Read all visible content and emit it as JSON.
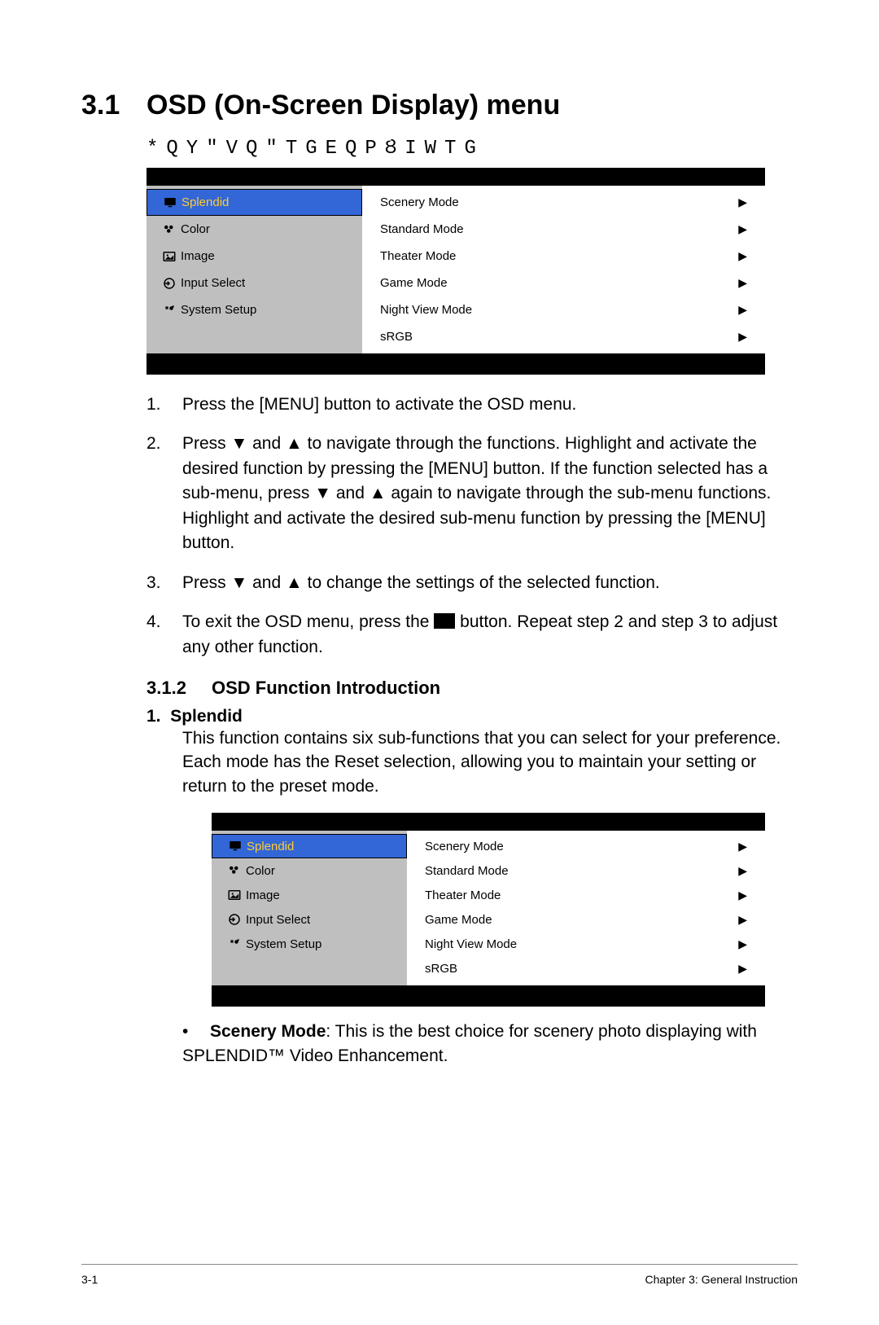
{
  "section": {
    "number": "3.1",
    "title": "OSD (On-Screen Display) menu"
  },
  "config_line": "*QY\"VQ\"TGEQPȢIWTG",
  "osd": {
    "left_items": [
      {
        "label": "Splendid",
        "icon": "monitor",
        "selected": true
      },
      {
        "label": "Color",
        "icon": "palette",
        "selected": false
      },
      {
        "label": "Image",
        "icon": "image",
        "selected": false
      },
      {
        "label": "Input Select",
        "icon": "input",
        "selected": false
      },
      {
        "label": "System Setup",
        "icon": "tools",
        "selected": false
      }
    ],
    "right_items": [
      "Scenery Mode",
      "Standard Mode",
      "Theater Mode",
      "Game Mode",
      "Night View Mode",
      "sRGB"
    ]
  },
  "steps": {
    "1": "Press the [MENU] button to activate the OSD menu.",
    "2": "Press ▼ and ▲ to navigate through the functions. Highlight and activate the desired function by pressing the [MENU] button. If the function selected has a sub-menu, press ▼ and ▲ again to navigate through the sub-menu functions. Highlight and activate the desired sub-menu function by pressing the [MENU] button.",
    "3": "Press ▼ and ▲ to change the settings of the selected function.",
    "4a": "To exit the OSD menu, press the ",
    "4b": " button. Repeat step 2 and step 3 to adjust any other function."
  },
  "sub": {
    "number": "3.1.2",
    "title": "OSD Function Introduction"
  },
  "splendid": {
    "lead_num": "1.",
    "lead_name": "Splendid",
    "body": "This function contains six sub-functions that you can select for your preference. Each mode has the Reset selection, allowing you to maintain your setting or return to the preset mode."
  },
  "mode": {
    "bullet": "•",
    "name": "Scenery Mode",
    "desc": ": This is the best choice for scenery photo displaying with SPLENDID™ Video Enhancement."
  },
  "footer": {
    "page": "3-1",
    "chapter": "Chapter 3: General Instruction"
  }
}
